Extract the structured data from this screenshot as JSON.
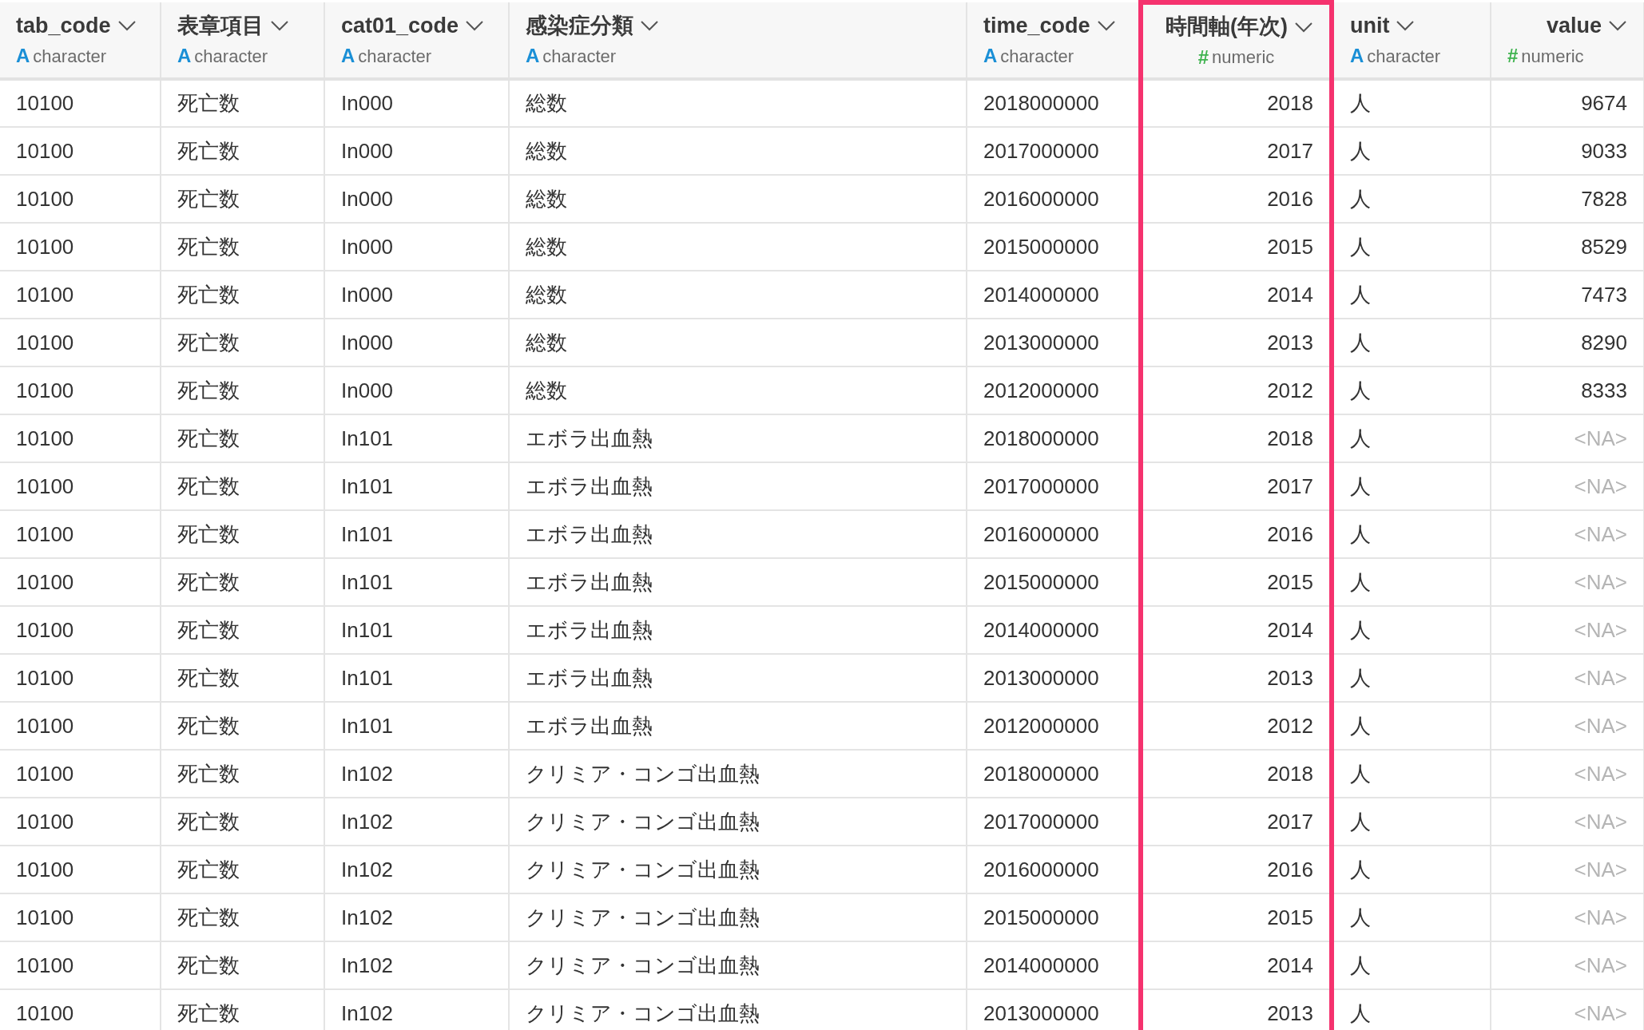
{
  "columns": [
    {
      "name": "tab_code",
      "kind": "character",
      "type_glyph": "A",
      "type": "character",
      "selected": false
    },
    {
      "name": "表章項目",
      "kind": "character",
      "type_glyph": "A",
      "type": "character",
      "selected": false
    },
    {
      "name": "cat01_code",
      "kind": "character",
      "type_glyph": "A",
      "type": "character",
      "selected": false
    },
    {
      "name": "感染症分類",
      "kind": "character",
      "type_glyph": "A",
      "type": "character",
      "selected": false
    },
    {
      "name": "time_code",
      "kind": "character",
      "type_glyph": "A",
      "type": "character",
      "selected": false
    },
    {
      "name": "時間軸(年次)",
      "kind": "numeric",
      "type_glyph": "#",
      "type": "numeric",
      "selected": true
    },
    {
      "name": "unit",
      "kind": "character",
      "type_glyph": "A",
      "type": "character",
      "selected": false
    },
    {
      "name": "value",
      "kind": "numeric",
      "type_glyph": "#",
      "type": "numeric",
      "selected": false
    }
  ],
  "rows": [
    {
      "cells": [
        "10100",
        "死亡数",
        "In000",
        "総数",
        "2018000000",
        "2018",
        "人",
        "9674"
      ],
      "value_missing": false
    },
    {
      "cells": [
        "10100",
        "死亡数",
        "In000",
        "総数",
        "2017000000",
        "2017",
        "人",
        "9033"
      ],
      "value_missing": false
    },
    {
      "cells": [
        "10100",
        "死亡数",
        "In000",
        "総数",
        "2016000000",
        "2016",
        "人",
        "7828"
      ],
      "value_missing": false
    },
    {
      "cells": [
        "10100",
        "死亡数",
        "In000",
        "総数",
        "2015000000",
        "2015",
        "人",
        "8529"
      ],
      "value_missing": false
    },
    {
      "cells": [
        "10100",
        "死亡数",
        "In000",
        "総数",
        "2014000000",
        "2014",
        "人",
        "7473"
      ],
      "value_missing": false
    },
    {
      "cells": [
        "10100",
        "死亡数",
        "In000",
        "総数",
        "2013000000",
        "2013",
        "人",
        "8290"
      ],
      "value_missing": false
    },
    {
      "cells": [
        "10100",
        "死亡数",
        "In000",
        "総数",
        "2012000000",
        "2012",
        "人",
        "8333"
      ],
      "value_missing": false
    },
    {
      "cells": [
        "10100",
        "死亡数",
        "In101",
        "エボラ出血熱",
        "2018000000",
        "2018",
        "人",
        "<NA>"
      ],
      "value_missing": true
    },
    {
      "cells": [
        "10100",
        "死亡数",
        "In101",
        "エボラ出血熱",
        "2017000000",
        "2017",
        "人",
        "<NA>"
      ],
      "value_missing": true
    },
    {
      "cells": [
        "10100",
        "死亡数",
        "In101",
        "エボラ出血熱",
        "2016000000",
        "2016",
        "人",
        "<NA>"
      ],
      "value_missing": true
    },
    {
      "cells": [
        "10100",
        "死亡数",
        "In101",
        "エボラ出血熱",
        "2015000000",
        "2015",
        "人",
        "<NA>"
      ],
      "value_missing": true
    },
    {
      "cells": [
        "10100",
        "死亡数",
        "In101",
        "エボラ出血熱",
        "2014000000",
        "2014",
        "人",
        "<NA>"
      ],
      "value_missing": true
    },
    {
      "cells": [
        "10100",
        "死亡数",
        "In101",
        "エボラ出血熱",
        "2013000000",
        "2013",
        "人",
        "<NA>"
      ],
      "value_missing": true
    },
    {
      "cells": [
        "10100",
        "死亡数",
        "In101",
        "エボラ出血熱",
        "2012000000",
        "2012",
        "人",
        "<NA>"
      ],
      "value_missing": true
    },
    {
      "cells": [
        "10100",
        "死亡数",
        "In102",
        "クリミア・コンゴ出血熱",
        "2018000000",
        "2018",
        "人",
        "<NA>"
      ],
      "value_missing": true
    },
    {
      "cells": [
        "10100",
        "死亡数",
        "In102",
        "クリミア・コンゴ出血熱",
        "2017000000",
        "2017",
        "人",
        "<NA>"
      ],
      "value_missing": true
    },
    {
      "cells": [
        "10100",
        "死亡数",
        "In102",
        "クリミア・コンゴ出血熱",
        "2016000000",
        "2016",
        "人",
        "<NA>"
      ],
      "value_missing": true
    },
    {
      "cells": [
        "10100",
        "死亡数",
        "In102",
        "クリミア・コンゴ出血熱",
        "2015000000",
        "2015",
        "人",
        "<NA>"
      ],
      "value_missing": true
    },
    {
      "cells": [
        "10100",
        "死亡数",
        "In102",
        "クリミア・コンゴ出血熱",
        "2014000000",
        "2014",
        "人",
        "<NA>"
      ],
      "value_missing": true
    },
    {
      "cells": [
        "10100",
        "死亡数",
        "In102",
        "クリミア・コンゴ出血熱",
        "2013000000",
        "2013",
        "人",
        "<NA>"
      ],
      "value_missing": true
    }
  ]
}
